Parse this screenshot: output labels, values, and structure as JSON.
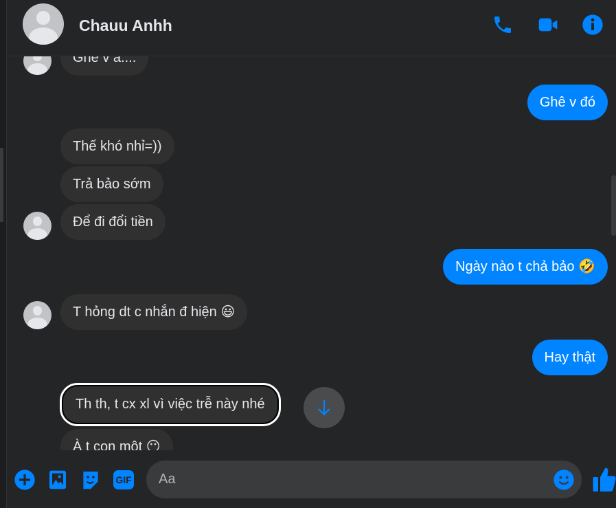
{
  "header": {
    "contact_name": "Chauu Anhh",
    "icons": [
      "phone-icon",
      "video-camera-icon",
      "info-icon"
    ]
  },
  "accent_color": "#0084ff",
  "messages": [
    {
      "direction": "in",
      "text": "Ghê v a....",
      "avatar": true
    },
    {
      "direction": "out",
      "text": "Ghê v đó"
    },
    {
      "direction": "in",
      "text": "Thế khó nhỉ=))"
    },
    {
      "direction": "in",
      "text": "Trả bảo sớm"
    },
    {
      "direction": "in",
      "text": "Để đi đổi tiền",
      "avatar": true
    },
    {
      "direction": "out",
      "text": "Ngày nào t chả bảo 🤣"
    },
    {
      "direction": "in",
      "text": "T hỏng dt c nhắn đ hiện 😃",
      "avatar": true
    },
    {
      "direction": "out",
      "text": "Hay thật"
    },
    {
      "direction": "in",
      "text": "Th th, t cx xl vì việc trễ này nhé",
      "selected": true
    },
    {
      "direction": "in",
      "text": "À t con một 😶"
    }
  ],
  "composer": {
    "placeholder": "Aa",
    "icons": [
      "plus-icon",
      "image-icon",
      "sticker-icon",
      "gif-icon",
      "emoji-icon",
      "thumbs-up-icon"
    ],
    "gif_label": "GIF"
  }
}
